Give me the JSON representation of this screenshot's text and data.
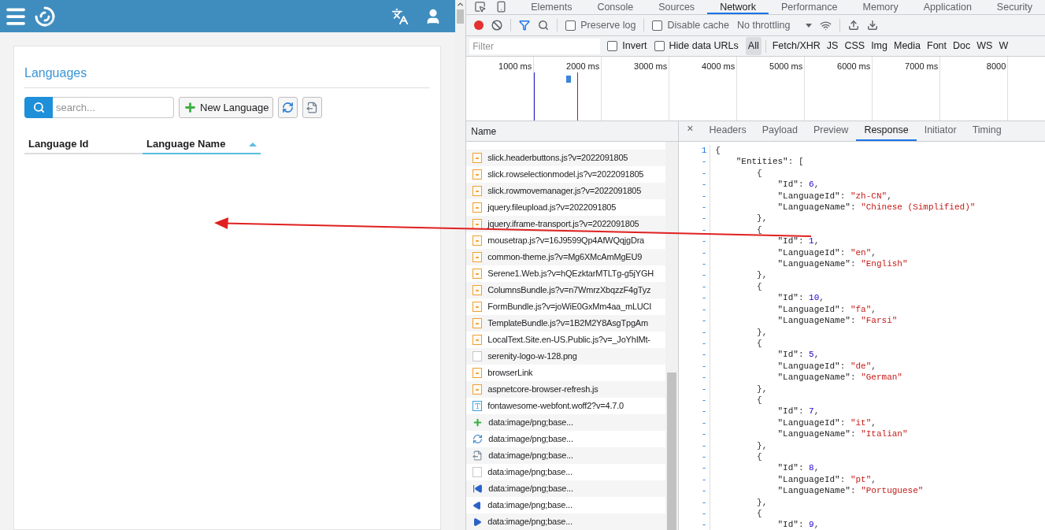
{
  "app": {
    "title": "Languages",
    "search_placeholder": "search...",
    "new_button": "New Language",
    "columns": [
      {
        "label": "Language Id",
        "sorted": false
      },
      {
        "label": "Language Name",
        "sorted": true
      }
    ]
  },
  "devtools": {
    "tabs": [
      {
        "label": "Elements",
        "selected": false
      },
      {
        "label": "Console",
        "selected": false
      },
      {
        "label": "Sources",
        "selected": false
      },
      {
        "label": "Network",
        "selected": true
      },
      {
        "label": "Performance",
        "selected": false
      },
      {
        "label": "Memory",
        "selected": false
      },
      {
        "label": "Application",
        "selected": false
      },
      {
        "label": "Security",
        "selected": false
      }
    ],
    "toolbar": {
      "recording": true,
      "preserve_log": {
        "label": "Preserve log",
        "checked": false
      },
      "disable_cache": {
        "label": "Disable cache",
        "checked": false
      },
      "throttling": "No throttling"
    },
    "filter": {
      "placeholder": "Filter",
      "invert": {
        "label": "Invert",
        "checked": false
      },
      "hide_data_urls": {
        "label": "Hide data URLs",
        "checked": false
      },
      "types": [
        {
          "label": "All",
          "selected": true
        },
        {
          "label": "Fetch/XHR",
          "selected": false
        },
        {
          "label": "JS",
          "selected": false
        },
        {
          "label": "CSS",
          "selected": false
        },
        {
          "label": "Img",
          "selected": false
        },
        {
          "label": "Media",
          "selected": false
        },
        {
          "label": "Font",
          "selected": false
        },
        {
          "label": "Doc",
          "selected": false
        },
        {
          "label": "WS",
          "selected": false
        },
        {
          "label": "W",
          "selected": false
        }
      ]
    },
    "timeline_ticks": [
      "1000 ms",
      "2000 ms",
      "3000 ms",
      "4000 ms",
      "5000 ms",
      "6000 ms",
      "7000 ms",
      "8000"
    ],
    "requests": {
      "header": "Name",
      "rows": [
        {
          "name": "slick.headerbuttons.js?v=2022091805",
          "kind": "script"
        },
        {
          "name": "slick.rowselectionmodel.js?v=2022091805",
          "kind": "script"
        },
        {
          "name": "slick.rowmovemanager.js?v=2022091805",
          "kind": "script"
        },
        {
          "name": "jquery.fileupload.js?v=2022091805",
          "kind": "script"
        },
        {
          "name": "jquery.iframe-transport.js?v=2022091805",
          "kind": "script"
        },
        {
          "name": "mousetrap.js?v=16J9599Qp4AfWQqjgDra",
          "kind": "script"
        },
        {
          "name": "common-theme.js?v=Mg6XMcAmMgEU9",
          "kind": "script"
        },
        {
          "name": "Serene1.Web.js?v=hQEzktarMTLTg-g5jYGH",
          "kind": "script"
        },
        {
          "name": "ColumnsBundle.js?v=n7WmrzXbqzzF4gTyz",
          "kind": "script"
        },
        {
          "name": "FormBundle.js?v=joWiE0GxMm4aa_mLUCI",
          "kind": "script"
        },
        {
          "name": "TemplateBundle.js?v=1B2M2Y8AsgTpgAm",
          "kind": "script"
        },
        {
          "name": "LocalText.Site.en-US.Public.js?v=_JoYhIMt-",
          "kind": "script"
        },
        {
          "name": "serenity-logo-w-128.png",
          "kind": "blank"
        },
        {
          "name": "browserLink",
          "kind": "script"
        },
        {
          "name": "aspnetcore-browser-refresh.js",
          "kind": "script"
        },
        {
          "name": "fontawesome-webfont.woff2?v=4.7.0",
          "kind": "font"
        },
        {
          "name": "data:image/png;base...",
          "kind": "plus"
        },
        {
          "name": "data:image/png;base...",
          "kind": "refresh"
        },
        {
          "name": "data:image/png;base...",
          "kind": "export"
        },
        {
          "name": "data:image/png;base...",
          "kind": "blank"
        },
        {
          "name": "data:image/png;base...",
          "kind": "first"
        },
        {
          "name": "data:image/png;base...",
          "kind": "prev"
        },
        {
          "name": "data:image/png;base...",
          "kind": "next"
        }
      ]
    },
    "detail": {
      "close": "×",
      "tabs": [
        {
          "label": "Headers",
          "selected": false
        },
        {
          "label": "Payload",
          "selected": false
        },
        {
          "label": "Preview",
          "selected": false
        },
        {
          "label": "Response",
          "selected": true
        },
        {
          "label": "Initiator",
          "selected": false
        },
        {
          "label": "Timing",
          "selected": false
        }
      ],
      "lines": [
        {
          "gutter": "1",
          "tokens": [
            {
              "kind": "punct",
              "text": "{"
            }
          ]
        },
        {
          "gutter": "-",
          "tokens": [
            {
              "kind": "key",
              "text": "    \"Entities\""
            },
            {
              "kind": "punct",
              "text": ": ["
            }
          ]
        },
        {
          "gutter": "-",
          "tokens": [
            {
              "kind": "punct",
              "text": "        {"
            }
          ]
        },
        {
          "gutter": "-",
          "tokens": [
            {
              "kind": "key",
              "text": "            \"Id\""
            },
            {
              "kind": "punct",
              "text": ": "
            },
            {
              "kind": "num",
              "text": "6"
            },
            {
              "kind": "punct",
              "text": ","
            }
          ]
        },
        {
          "gutter": "-",
          "tokens": [
            {
              "kind": "key",
              "text": "            \"LanguageId\""
            },
            {
              "kind": "punct",
              "text": ": "
            },
            {
              "kind": "str",
              "text": "\"zh-CN\""
            },
            {
              "kind": "punct",
              "text": ","
            }
          ]
        },
        {
          "gutter": "-",
          "tokens": [
            {
              "kind": "key",
              "text": "            \"LanguageName\""
            },
            {
              "kind": "punct",
              "text": ": "
            },
            {
              "kind": "str",
              "text": "\"Chinese (Simplified)\""
            }
          ]
        },
        {
          "gutter": "-",
          "tokens": [
            {
              "kind": "punct",
              "text": "        },"
            }
          ]
        },
        {
          "gutter": "-",
          "tokens": [
            {
              "kind": "punct",
              "text": "        {"
            }
          ]
        },
        {
          "gutter": "-",
          "tokens": [
            {
              "kind": "key",
              "text": "            \"Id\""
            },
            {
              "kind": "punct",
              "text": ": "
            },
            {
              "kind": "num",
              "text": "1"
            },
            {
              "kind": "punct",
              "text": ","
            }
          ]
        },
        {
          "gutter": "-",
          "tokens": [
            {
              "kind": "key",
              "text": "            \"LanguageId\""
            },
            {
              "kind": "punct",
              "text": ": "
            },
            {
              "kind": "str",
              "text": "\"en\""
            },
            {
              "kind": "punct",
              "text": ","
            }
          ]
        },
        {
          "gutter": "-",
          "tokens": [
            {
              "kind": "key",
              "text": "            \"LanguageName\""
            },
            {
              "kind": "punct",
              "text": ": "
            },
            {
              "kind": "str",
              "text": "\"English\""
            }
          ]
        },
        {
          "gutter": "-",
          "tokens": [
            {
              "kind": "punct",
              "text": "        },"
            }
          ]
        },
        {
          "gutter": "-",
          "tokens": [
            {
              "kind": "punct",
              "text": "        {"
            }
          ]
        },
        {
          "gutter": "-",
          "tokens": [
            {
              "kind": "key",
              "text": "            \"Id\""
            },
            {
              "kind": "punct",
              "text": ": "
            },
            {
              "kind": "num",
              "text": "10"
            },
            {
              "kind": "punct",
              "text": ","
            }
          ]
        },
        {
          "gutter": "-",
          "tokens": [
            {
              "kind": "key",
              "text": "            \"LanguageId\""
            },
            {
              "kind": "punct",
              "text": ": "
            },
            {
              "kind": "str",
              "text": "\"fa\""
            },
            {
              "kind": "punct",
              "text": ","
            }
          ]
        },
        {
          "gutter": "-",
          "tokens": [
            {
              "kind": "key",
              "text": "            \"LanguageName\""
            },
            {
              "kind": "punct",
              "text": ": "
            },
            {
              "kind": "str",
              "text": "\"Farsi\""
            }
          ]
        },
        {
          "gutter": "-",
          "tokens": [
            {
              "kind": "punct",
              "text": "        },"
            }
          ]
        },
        {
          "gutter": "-",
          "tokens": [
            {
              "kind": "punct",
              "text": "        {"
            }
          ]
        },
        {
          "gutter": "-",
          "tokens": [
            {
              "kind": "key",
              "text": "            \"Id\""
            },
            {
              "kind": "punct",
              "text": ": "
            },
            {
              "kind": "num",
              "text": "5"
            },
            {
              "kind": "punct",
              "text": ","
            }
          ]
        },
        {
          "gutter": "-",
          "tokens": [
            {
              "kind": "key",
              "text": "            \"LanguageId\""
            },
            {
              "kind": "punct",
              "text": ": "
            },
            {
              "kind": "str",
              "text": "\"de\""
            },
            {
              "kind": "punct",
              "text": ","
            }
          ]
        },
        {
          "gutter": "-",
          "tokens": [
            {
              "kind": "key",
              "text": "            \"LanguageName\""
            },
            {
              "kind": "punct",
              "text": ": "
            },
            {
              "kind": "str",
              "text": "\"German\""
            }
          ]
        },
        {
          "gutter": "-",
          "tokens": [
            {
              "kind": "punct",
              "text": "        },"
            }
          ]
        },
        {
          "gutter": "-",
          "tokens": [
            {
              "kind": "punct",
              "text": "        {"
            }
          ]
        },
        {
          "gutter": "-",
          "tokens": [
            {
              "kind": "key",
              "text": "            \"Id\""
            },
            {
              "kind": "punct",
              "text": ": "
            },
            {
              "kind": "num",
              "text": "7"
            },
            {
              "kind": "punct",
              "text": ","
            }
          ]
        },
        {
          "gutter": "-",
          "tokens": [
            {
              "kind": "key",
              "text": "            \"LanguageId\""
            },
            {
              "kind": "punct",
              "text": ": "
            },
            {
              "kind": "str",
              "text": "\"it\""
            },
            {
              "kind": "punct",
              "text": ","
            }
          ]
        },
        {
          "gutter": "-",
          "tokens": [
            {
              "kind": "key",
              "text": "            \"LanguageName\""
            },
            {
              "kind": "punct",
              "text": ": "
            },
            {
              "kind": "str",
              "text": "\"Italian\""
            }
          ]
        },
        {
          "gutter": "-",
          "tokens": [
            {
              "kind": "punct",
              "text": "        },"
            }
          ]
        },
        {
          "gutter": "-",
          "tokens": [
            {
              "kind": "punct",
              "text": "        {"
            }
          ]
        },
        {
          "gutter": "-",
          "tokens": [
            {
              "kind": "key",
              "text": "            \"Id\""
            },
            {
              "kind": "punct",
              "text": ": "
            },
            {
              "kind": "num",
              "text": "8"
            },
            {
              "kind": "punct",
              "text": ","
            }
          ]
        },
        {
          "gutter": "-",
          "tokens": [
            {
              "kind": "key",
              "text": "            \"LanguageId\""
            },
            {
              "kind": "punct",
              "text": ": "
            },
            {
              "kind": "str",
              "text": "\"pt\""
            },
            {
              "kind": "punct",
              "text": ","
            }
          ]
        },
        {
          "gutter": "-",
          "tokens": [
            {
              "kind": "key",
              "text": "            \"LanguageName\""
            },
            {
              "kind": "punct",
              "text": ": "
            },
            {
              "kind": "str",
              "text": "\"Portuguese\""
            }
          ]
        },
        {
          "gutter": "-",
          "tokens": [
            {
              "kind": "punct",
              "text": "        },"
            }
          ]
        },
        {
          "gutter": "-",
          "tokens": [
            {
              "kind": "punct",
              "text": "        {"
            }
          ]
        },
        {
          "gutter": "-",
          "tokens": [
            {
              "kind": "key",
              "text": "            \"Id\""
            },
            {
              "kind": "punct",
              "text": ": "
            },
            {
              "kind": "num",
              "text": "9"
            },
            {
              "kind": "punct",
              "text": ","
            }
          ]
        }
      ]
    }
  }
}
